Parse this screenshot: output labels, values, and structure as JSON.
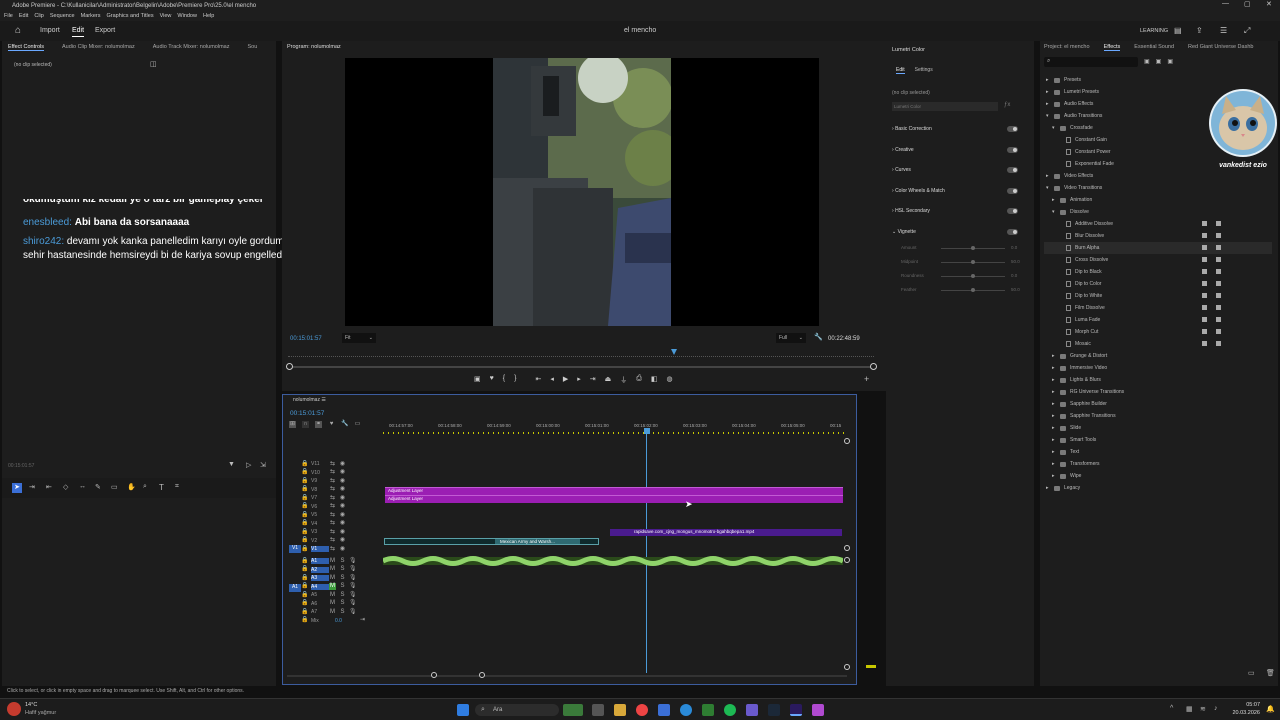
{
  "window": {
    "title": "Adobe Premiere - C:\\Kullanicilar\\Administrator\\Belgelin\\Adobe\\Premiere Pro\\25.0\\el mencho"
  },
  "menu": [
    "File",
    "Edit",
    "Clip",
    "Sequence",
    "Markers",
    "Graphics and Titles",
    "View",
    "Window",
    "Help"
  ],
  "appbar": {
    "import": "Import",
    "edit": "Edit",
    "export": "Export",
    "project_name": "el mencho",
    "workspace": "LEARNING"
  },
  "left_panel": {
    "tabs": [
      "Effect Controls",
      "Audio Clip Mixer: nolumolmaz",
      "Audio Track Mixer: nolumolmaz",
      "Sou"
    ],
    "no_clip": "(no clip selected)",
    "timecode": "00:15:01:57"
  },
  "chat": [
    {
      "user": "",
      "text": "okumuştum kız kedalı ye o tarz bir gameplay çeker"
    },
    {
      "user": "enesbleed:",
      "text": "Abi bana da sorsanaaaa"
    },
    {
      "user": "shiro242:",
      "text": "devamı yok kanka panelledim karıyı oyle gordum izmir sehir hastanesinde hemsireydi bi de kariya sovup engelledim"
    }
  ],
  "program": {
    "title": "Program: nolumolmaz",
    "timecode": "00:15:01:57",
    "fit": "Fit",
    "quality": "Full",
    "duration": "00:22:48:59"
  },
  "timeline": {
    "sequence": "nolumolmaz",
    "timecode": "00:15:01:57",
    "ruler": [
      "00:14:57:00",
      "00:14:58:00",
      "00:14:59:00",
      "00:15:00:00",
      "00:15:01:00",
      "00:15:02:00",
      "00:15:03:00",
      "00:15:04:00",
      "00:15:05:00",
      "00:15"
    ],
    "video_tracks": [
      "V11",
      "V10",
      "V9",
      "V8",
      "V7",
      "V6",
      "V5",
      "V4",
      "V3",
      "V2",
      "V1"
    ],
    "audio_tracks": [
      "A1",
      "A2",
      "A3",
      "A4",
      "A5",
      "A6",
      "A7"
    ],
    "mix_label": "Mix",
    "mix_value": "0.0",
    "adjustment_layer_1": "Adjustment Layer",
    "adjustment_layer_2": "Adjustment Layer",
    "clip_mp4": "rapidsave.com_cjng_mongus_mnomotro-bgahbqbepa1.mp4",
    "clip_mexican": "Mexican Army and Warsh..."
  },
  "lumetri": {
    "title": "Lumetri Color",
    "tabs": [
      "Edit",
      "Settings"
    ],
    "no_clip": "(no clip selected)",
    "preset": "Lumetri Color",
    "sections": [
      "Basic Correction",
      "Creative",
      "Curves",
      "Color Wheels & Match",
      "HSL Secondary",
      "Vignette"
    ],
    "vignette_params": [
      {
        "label": "Amount",
        "value": "0.0"
      },
      {
        "label": "Midpoint",
        "value": "50.0"
      },
      {
        "label": "Roundness",
        "value": "0.0"
      },
      {
        "label": "Feather",
        "value": "50.0"
      }
    ]
  },
  "effects": {
    "tabs": [
      "Project: el mencho",
      "Effects",
      "Essential Sound",
      "Red Giant Universe Dashb"
    ],
    "items": [
      {
        "label": "Presets",
        "kind": "folder",
        "level": 0,
        "arrow": "▸"
      },
      {
        "label": "Lumetri Presets",
        "kind": "folder",
        "level": 0,
        "arrow": "▸"
      },
      {
        "label": "Audio Effects",
        "kind": "folder",
        "level": 0,
        "arrow": "▸"
      },
      {
        "label": "Audio Transitions",
        "kind": "folder",
        "level": 0,
        "arrow": "▾"
      },
      {
        "label": "Crossfade",
        "kind": "folder",
        "level": 1,
        "arrow": "▾"
      },
      {
        "label": "Constant Gain",
        "kind": "fx",
        "level": 2,
        "arrow": ""
      },
      {
        "label": "Constant Power",
        "kind": "fx",
        "level": 2,
        "arrow": ""
      },
      {
        "label": "Exponential Fade",
        "kind": "fx",
        "level": 2,
        "arrow": ""
      },
      {
        "label": "Video Effects",
        "kind": "folder",
        "level": 0,
        "arrow": "▸"
      },
      {
        "label": "Video Transitions",
        "kind": "folder",
        "level": 0,
        "arrow": "▾"
      },
      {
        "label": "Animation",
        "kind": "folder",
        "level": 1,
        "arrow": "▸"
      },
      {
        "label": "Dissolve",
        "kind": "folder",
        "level": 1,
        "arrow": "▾"
      },
      {
        "label": "Additive Dissolve",
        "kind": "fx",
        "level": 2,
        "arrow": "",
        "acc": true
      },
      {
        "label": "Blur Dissolve",
        "kind": "fx",
        "level": 2,
        "arrow": "",
        "acc": true
      },
      {
        "label": "Burn Alpha",
        "kind": "fx",
        "level": 2,
        "arrow": "",
        "acc": true
      },
      {
        "label": "Cross Dissolve",
        "kind": "fx",
        "level": 2,
        "arrow": "",
        "acc": true
      },
      {
        "label": "Dip to Black",
        "kind": "fx",
        "level": 2,
        "arrow": "",
        "acc": true
      },
      {
        "label": "Dip to Color",
        "kind": "fx",
        "level": 2,
        "arrow": "",
        "acc": true
      },
      {
        "label": "Dip to White",
        "kind": "fx",
        "level": 2,
        "arrow": "",
        "acc": true
      },
      {
        "label": "Film Dissolve",
        "kind": "fx",
        "level": 2,
        "arrow": "",
        "acc": true
      },
      {
        "label": "Luma Fade",
        "kind": "fx",
        "level": 2,
        "arrow": "",
        "acc": true
      },
      {
        "label": "Morph Cut",
        "kind": "fx",
        "level": 2,
        "arrow": "",
        "acc": true
      },
      {
        "label": "Mosaic",
        "kind": "fx",
        "level": 2,
        "arrow": "",
        "acc": true
      },
      {
        "label": "Grunge & Distort",
        "kind": "folder",
        "level": 1,
        "arrow": "▸"
      },
      {
        "label": "Immersive Video",
        "kind": "folder",
        "level": 1,
        "arrow": "▸"
      },
      {
        "label": "Lights & Blurs",
        "kind": "folder",
        "level": 1,
        "arrow": "▸"
      },
      {
        "label": "RG Universe Transitions",
        "kind": "folder",
        "level": 1,
        "arrow": "▸"
      },
      {
        "label": "Sapphire Builder",
        "kind": "folder",
        "level": 1,
        "arrow": "▸"
      },
      {
        "label": "Sapphire Transitions",
        "kind": "folder",
        "level": 1,
        "arrow": "▸"
      },
      {
        "label": "Slide",
        "kind": "folder",
        "level": 1,
        "arrow": "▸"
      },
      {
        "label": "Smart Tools",
        "kind": "folder",
        "level": 1,
        "arrow": "▸"
      },
      {
        "label": "Text",
        "kind": "folder",
        "level": 1,
        "arrow": "▸"
      },
      {
        "label": "Transformers",
        "kind": "folder",
        "level": 1,
        "arrow": "▸"
      },
      {
        "label": "Wipe",
        "kind": "folder",
        "level": 1,
        "arrow": "▸"
      },
      {
        "label": "Legacy",
        "kind": "folder",
        "level": 0,
        "arrow": "▸"
      }
    ]
  },
  "webcam_label": "vankedist ezio",
  "status_hint": "Click to select, or click in empty space and drag to marquee select. Use Shift, Alt, and Ctrl for other options.",
  "taskbar": {
    "temp": "14°C",
    "weather": "Hafif yağmur",
    "search": "Ara",
    "time": "05:07",
    "date": "20.03.2026"
  }
}
